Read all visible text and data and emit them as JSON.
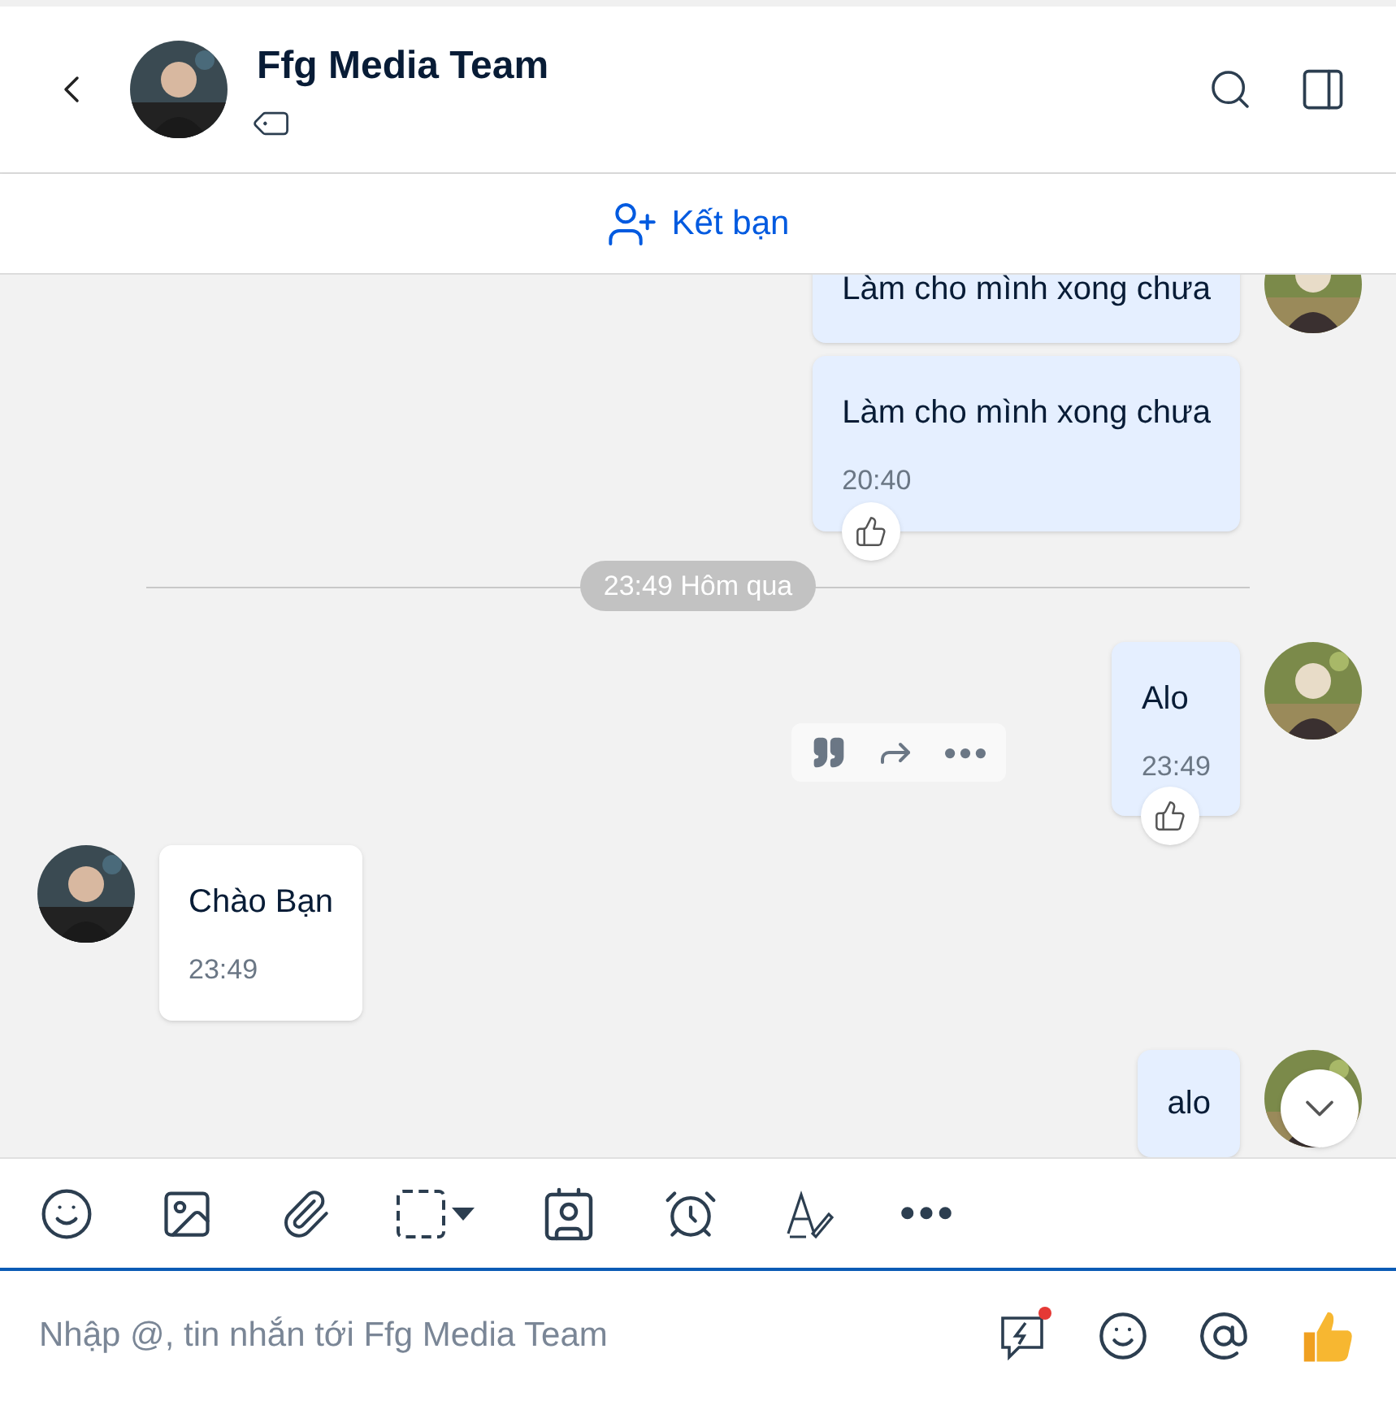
{
  "header": {
    "title": "Ffg Media Team"
  },
  "add_friend": {
    "label": "Kết bạn"
  },
  "messages": [
    {
      "kind": "outgoing",
      "text": "Làm cho mình xong chưa",
      "show_avatar": true,
      "reaction_button": false,
      "actions": false
    },
    {
      "kind": "outgoing",
      "text": "Làm cho mình xong chưa",
      "time": "20:40",
      "show_avatar": false,
      "reaction_button": true,
      "actions": false
    },
    {
      "kind": "divider",
      "text": "23:49 Hôm qua"
    },
    {
      "kind": "outgoing",
      "text": "Alo",
      "time": "23:49",
      "show_avatar": true,
      "reaction_button": true,
      "actions": true
    },
    {
      "kind": "incoming",
      "text": "Chào Bạn",
      "time": "23:49",
      "show_avatar": true,
      "reaction_button": false,
      "actions": false
    },
    {
      "kind": "outgoing",
      "text": "alo",
      "show_avatar": true,
      "reaction_button": false,
      "actions": false
    }
  ],
  "composer": {
    "placeholder": "Nhập @, tin nhắn tới Ffg Media Team",
    "quick_message_badge": true
  }
}
